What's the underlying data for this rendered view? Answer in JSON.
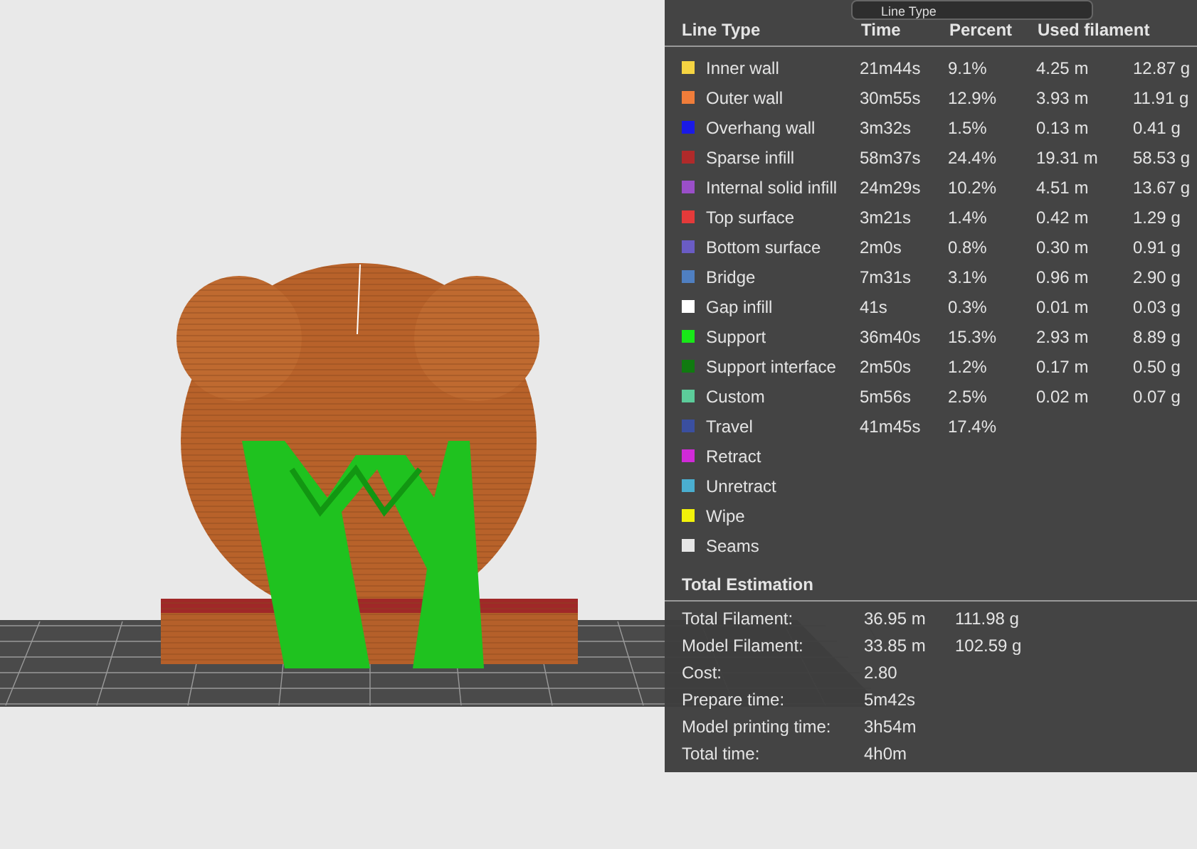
{
  "view_selector": {
    "label": "Line Type"
  },
  "legend": {
    "columns": [
      "Line Type",
      "Time",
      "Percent",
      "Used filament"
    ],
    "rows": [
      {
        "name": "Inner wall",
        "time": "21m44s",
        "percent": "9.1%",
        "length": "4.25 m",
        "weight": "12.87 g",
        "color": "#f5d442"
      },
      {
        "name": "Outer wall",
        "time": "30m55s",
        "percent": "12.9%",
        "length": "3.93 m",
        "weight": "11.91 g",
        "color": "#f07d3a"
      },
      {
        "name": "Overhang wall",
        "time": "3m32s",
        "percent": "1.5%",
        "length": "0.13 m",
        "weight": "0.41 g",
        "color": "#1a1ae6"
      },
      {
        "name": "Sparse infill",
        "time": "58m37s",
        "percent": "24.4%",
        "length": "19.31 m",
        "weight": "58.53 g",
        "color": "#b02a2a"
      },
      {
        "name": "Internal solid infill",
        "time": "24m29s",
        "percent": "10.2%",
        "length": "4.51 m",
        "weight": "13.67 g",
        "color": "#9a4fc9"
      },
      {
        "name": "Top surface",
        "time": "3m21s",
        "percent": "1.4%",
        "length": "0.42 m",
        "weight": "1.29 g",
        "color": "#e43a3a"
      },
      {
        "name": "Bottom surface",
        "time": "2m0s",
        "percent": "0.8%",
        "length": "0.30 m",
        "weight": "0.91 g",
        "color": "#6a5cc4"
      },
      {
        "name": "Bridge",
        "time": "7m31s",
        "percent": "3.1%",
        "length": "0.96 m",
        "weight": "2.90 g",
        "color": "#4f7fc1"
      },
      {
        "name": "Gap infill",
        "time": "41s",
        "percent": "0.3%",
        "length": "0.01 m",
        "weight": "0.03 g",
        "color": "#ffffff"
      },
      {
        "name": "Support",
        "time": "36m40s",
        "percent": "15.3%",
        "length": "2.93 m",
        "weight": "8.89 g",
        "color": "#18e818"
      },
      {
        "name": "Support interface",
        "time": "2m50s",
        "percent": "1.2%",
        "length": "0.17 m",
        "weight": "0.50 g",
        "color": "#107a10"
      },
      {
        "name": "Custom",
        "time": "5m56s",
        "percent": "2.5%",
        "length": "0.02 m",
        "weight": "0.07 g",
        "color": "#5ccc9a"
      },
      {
        "name": "Travel",
        "time": "41m45s",
        "percent": "17.4%",
        "color": "#3a4fa0"
      },
      {
        "name": "Retract",
        "color": "#d02ad8"
      },
      {
        "name": "Unretract",
        "color": "#4aaed0"
      },
      {
        "name": "Wipe",
        "color": "#f2f20a"
      },
      {
        "name": "Seams",
        "color": "#e6e6e6"
      }
    ]
  },
  "total_estimation": {
    "title": "Total Estimation",
    "rows": [
      {
        "label": "Total Filament:",
        "values": [
          "36.95 m",
          "111.98 g"
        ]
      },
      {
        "label": "Model Filament:",
        "values": [
          "33.85 m",
          "102.59 g"
        ]
      },
      {
        "label": "Cost:",
        "values": [
          "2.80"
        ]
      },
      {
        "label": "Prepare time:",
        "values": [
          "5m42s"
        ]
      },
      {
        "label": "Model printing time:",
        "values": [
          "3h54m"
        ]
      },
      {
        "label": "Total time:",
        "values": [
          "4h0m"
        ]
      }
    ]
  }
}
